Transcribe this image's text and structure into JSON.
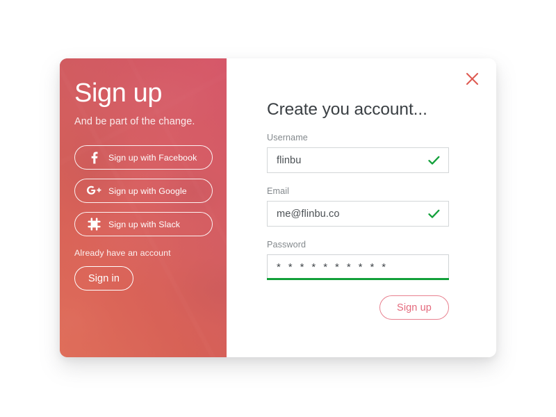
{
  "promo": {
    "title": "Sign up",
    "subtitle": "And be part of the change.",
    "social_buttons": [
      {
        "label": "Sign up with Facebook",
        "icon": "facebook-icon"
      },
      {
        "label": "Sign up with Google",
        "icon": "google-plus-icon"
      },
      {
        "label": "Sign up with Slack",
        "icon": "slack-icon"
      }
    ],
    "have_account_text": "Already have an account",
    "signin_label": "Sign in"
  },
  "form": {
    "title": "Create you account...",
    "close_icon": "close-icon",
    "fields": [
      {
        "label": "Username",
        "value": "flinbu",
        "valid": true,
        "valid_icon": "check-icon"
      },
      {
        "label": "Email",
        "value": "me@flinbu.co",
        "valid": true,
        "valid_icon": "check-icon"
      },
      {
        "label": "Password",
        "value": "* * * * * * * * * *",
        "valid": false,
        "focused": true
      }
    ],
    "submit_label": "Sign up"
  },
  "colors": {
    "gradient_start": "#e2705b",
    "gradient_end": "#d6556e",
    "accent_pink": "#e4697c",
    "valid_green": "#12a03a",
    "close_red": "#de5a52",
    "label_gray": "#83888c"
  }
}
